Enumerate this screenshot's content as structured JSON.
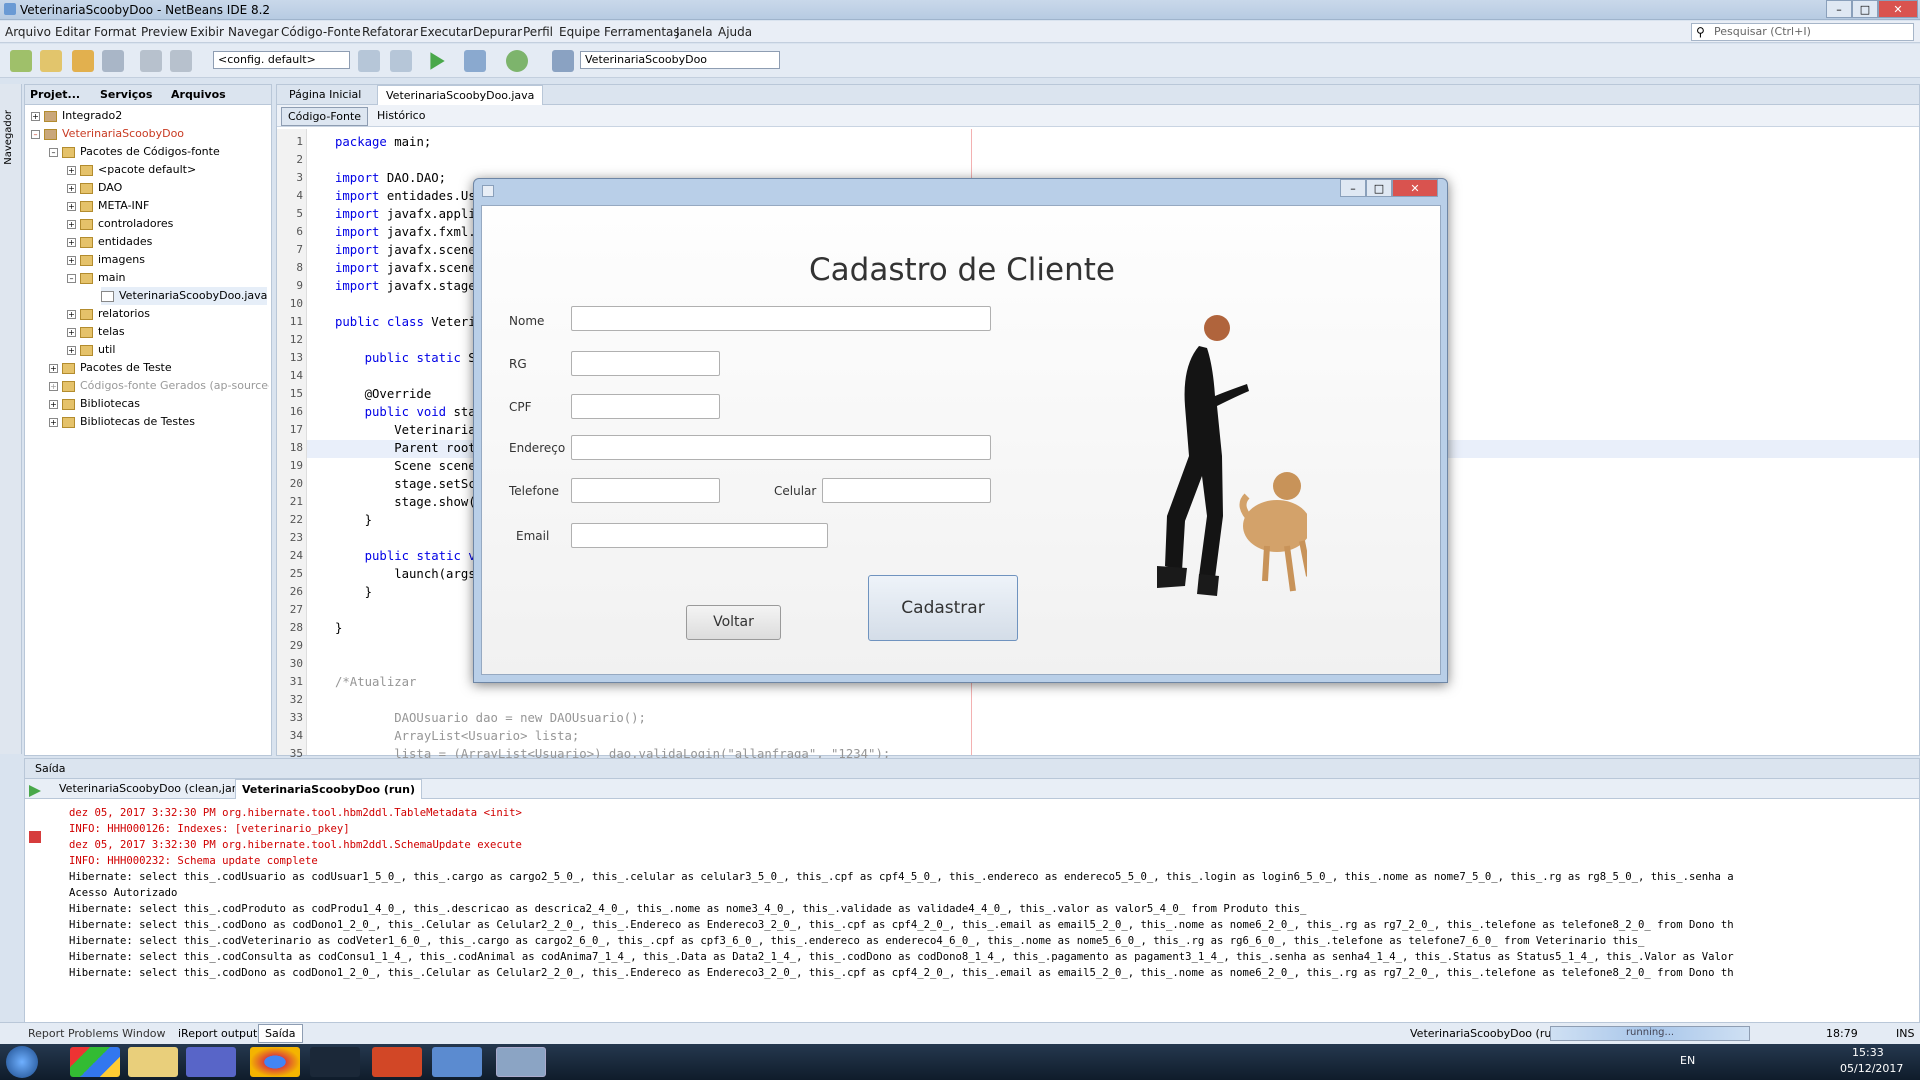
{
  "window": {
    "title": "VeterinariaScoobyDoo - NetBeans IDE 8.2"
  },
  "menu": [
    "Arquivo",
    "Editar",
    "Format",
    "Preview",
    "Exibir",
    "Navegar",
    "Código-Fonte",
    "Refatorar",
    "Executar",
    "Depurar",
    "Perfil",
    "Equipe",
    "Ferramentas",
    "Janela",
    "Ajuda"
  ],
  "search": {
    "placeholder": "Pesquisar (Ctrl+I)"
  },
  "toolbar": {
    "config": "<config. default>",
    "project": "VeterinariaScoobyDoo"
  },
  "left_strip": {
    "label": "Navegador"
  },
  "project_panel": {
    "tabs": [
      "Projet...",
      "Serviços",
      "Arquivos"
    ],
    "tree": [
      "Integrado2",
      "VeterinariaScoobyDoo",
      "Pacotes de Códigos-fonte",
      "<pacote default>",
      "DAO",
      "META-INF",
      "controladores",
      "entidades",
      "imagens",
      "main",
      "VeterinariaScoobyDoo.java",
      "relatorios",
      "telas",
      "util",
      "Pacotes de Teste",
      "Códigos-fonte Gerados (ap-source-output)",
      "Bibliotecas",
      "Bibliotecas de Testes"
    ]
  },
  "editor": {
    "tabs": [
      "Página Inicial",
      "VeterinariaScoobyDoo.java"
    ],
    "sub_tabs": [
      "Código-Fonte",
      "Histórico"
    ],
    "lines": [
      {
        "n": "1",
        "t": "package main;"
      },
      {
        "n": "2",
        "t": ""
      },
      {
        "n": "3",
        "t": "import DAO.DAO;"
      },
      {
        "n": "4",
        "t": "import entidades.Usuario;"
      },
      {
        "n": "5",
        "t": "import javafx.application.Application;"
      },
      {
        "n": "6",
        "t": "import javafx.fxml.FXMLLoader;"
      },
      {
        "n": "7",
        "t": "import javafx.scene.Parent;"
      },
      {
        "n": "8",
        "t": "import javafx.scene.Scene;"
      },
      {
        "n": "9",
        "t": "import javafx.stage.Stage;"
      },
      {
        "n": "10",
        "t": ""
      },
      {
        "n": "11",
        "t": "public class VeterinariaScoobyDoo extends Application {"
      },
      {
        "n": "12",
        "t": ""
      },
      {
        "n": "13",
        "t": "    public static Stage stage;"
      },
      {
        "n": "14",
        "t": ""
      },
      {
        "n": "15",
        "t": "    @Override"
      },
      {
        "n": "16",
        "t": "    public void start(Stage stage) throws Exception {"
      },
      {
        "n": "17",
        "t": "        VeterinariaScoobyDoo.stage = stage;"
      },
      {
        "n": "18",
        "t": "        Parent root = FXMLLoader.load(getClass().getResource(\"/telas/TelaLogin.fxml\"));"
      },
      {
        "n": "19",
        "t": "        Scene scene = new Scene(root);"
      },
      {
        "n": "20",
        "t": "        stage.setScene(scene);"
      },
      {
        "n": "21",
        "t": "        stage.show();"
      },
      {
        "n": "22",
        "t": "    }"
      },
      {
        "n": "23",
        "t": ""
      },
      {
        "n": "24",
        "t": "    public static void main(String[] args) {"
      },
      {
        "n": "25",
        "t": "        launch(args);"
      },
      {
        "n": "26",
        "t": "    }"
      },
      {
        "n": "27",
        "t": ""
      },
      {
        "n": "28",
        "t": "}"
      },
      {
        "n": "29",
        "t": ""
      },
      {
        "n": "30",
        "t": ""
      },
      {
        "n": "31",
        "t": "/*Atualizar"
      },
      {
        "n": "32",
        "t": ""
      },
      {
        "n": "33",
        "t": "        DAOUsuario dao = new DAOUsuario();"
      },
      {
        "n": "34",
        "t": "        ArrayList<Usuario> lista;"
      },
      {
        "n": "35",
        "t": "        lista = (ArrayList<Usuario>) dao.validaLogin(\"allanfraga\", \"1234\");"
      }
    ]
  },
  "output": {
    "title": "Saída",
    "tabs": [
      "VeterinariaScoobyDoo (clean,jar)",
      "VeterinariaScoobyDoo (run)"
    ],
    "lines": [
      {
        "t": "dez 05, 2017 3:32:30 PM org.hibernate.tool.hbm2ddl.TableMetadata <init>",
        "red": true
      },
      {
        "t": "INFO: HHH000126: Indexes: [veterinario_pkey]",
        "red": true
      },
      {
        "t": "dez 05, 2017 3:32:30 PM org.hibernate.tool.hbm2ddl.SchemaUpdate execute",
        "red": true
      },
      {
        "t": "INFO: HHH000232: Schema update complete",
        "red": true
      },
      {
        "t": "Hibernate: select this_.codUsuario as codUsuar1_5_0_, this_.cargo as cargo2_5_0_, this_.celular as celular3_5_0_, this_.cpf as cpf4_5_0_, this_.endereco as endereco5_5_0_, this_.login as login6_5_0_, this_.nome as nome7_5_0_, this_.rg as rg8_5_0_, this_.senha a",
        "red": false
      },
      {
        "t": "Acesso Autorizado",
        "red": false
      },
      {
        "t": "Hibernate: select this_.codProduto as codProdu1_4_0_, this_.descricao as descrica2_4_0_, this_.nome as nome3_4_0_, this_.validade as validade4_4_0_, this_.valor as valor5_4_0_ from Produto this_",
        "red": false
      },
      {
        "t": "Hibernate: select this_.codDono as codDono1_2_0_, this_.Celular as Celular2_2_0_, this_.Endereco as Endereco3_2_0_, this_.cpf as cpf4_2_0_, this_.email as email5_2_0_, this_.nome as nome6_2_0_, this_.rg as rg7_2_0_, this_.telefone as telefone8_2_0_ from Dono th",
        "red": false
      },
      {
        "t": "Hibernate: select this_.codVeterinario as codVeter1_6_0_, this_.cargo as cargo2_6_0_, this_.cpf as cpf3_6_0_, this_.endereco as endereco4_6_0_, this_.nome as nome5_6_0_, this_.rg as rg6_6_0_, this_.telefone as telefone7_6_0_ from Veterinario this_",
        "red": false
      },
      {
        "t": "Hibernate: select this_.codConsulta as codConsu1_1_4_, this_.codAnimal as codAnima7_1_4_, this_.Data as Data2_1_4_, this_.codDono as codDono8_1_4_, this_.pagamento as pagament3_1_4_, this_.senha as senha4_1_4_, this_.Status as Status5_1_4_, this_.Valor as Valor",
        "red": false
      },
      {
        "t": "Hibernate: select this_.codDono as codDono1_2_0_, this_.Celular as Celular2_2_0_, this_.Endereco as Endereco3_2_0_, this_.cpf as cpf4_2_0_, this_.email as email5_2_0_, this_.nome as nome6_2_0_, this_.rg as rg7_2_0_, this_.telefone as telefone8_2_0_ from Dono th",
        "red": false
      }
    ]
  },
  "statusbar": {
    "tabs": [
      "Report Problems Window",
      "iReport output",
      "Saída"
    ],
    "task": "VeterinariaScoobyDoo (run)",
    "progress": "running...",
    "caret": "18:79",
    "mode": "INS"
  },
  "taskbar": {
    "lang": "EN",
    "time": "15:33",
    "date": "05/12/2017"
  },
  "dialog": {
    "title": "Cadastro de Cliente",
    "labels": {
      "nome": "Nome",
      "rg": "RG",
      "cpf": "CPF",
      "endereco": "Endereço",
      "telefone": "Telefone",
      "celular": "Celular",
      "email": "Email"
    },
    "buttons": {
      "voltar": "Voltar",
      "cadastrar": "Cadastrar"
    }
  }
}
